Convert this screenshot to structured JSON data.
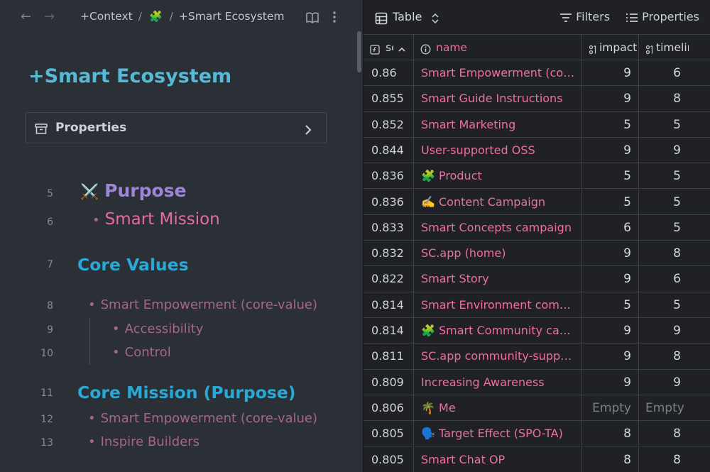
{
  "left": {
    "breadcrumb": {
      "first": "+Context",
      "separator": "/",
      "puzzle": "🧩",
      "last": "+Smart Ecosystem"
    },
    "page_title": "+Smart Ecosystem",
    "properties_label": "Properties",
    "lines": [
      {
        "num": "5",
        "text": "Purpose",
        "emoji": "⚔️"
      },
      {
        "num": "6",
        "text": "Smart Mission"
      },
      {
        "num": "7",
        "text": "Core Values"
      },
      {
        "num": "8",
        "text": "Smart Empowerment (core-value)"
      },
      {
        "num": "9",
        "text": "Accessibility"
      },
      {
        "num": "10",
        "text": "Control"
      },
      {
        "num": "11",
        "text": "Core Mission (Purpose)"
      },
      {
        "num": "12",
        "text": "Smart Empowerment (core-value)"
      },
      {
        "num": "13",
        "text": "Inspire Builders"
      }
    ],
    "bullet": "•"
  },
  "right": {
    "view_label": "Table",
    "filters_label": "Filters",
    "properties_label": "Properties",
    "columns": {
      "score": "score",
      "name": "name",
      "impact": "impact",
      "timeliness": "timeliness"
    },
    "rows": [
      {
        "score": "0.86",
        "name": "Smart Empowerment (core-value)",
        "impact": "9",
        "timeliness": "6"
      },
      {
        "score": "0.855",
        "name": "Smart Guide Instructions",
        "impact": "9",
        "timeliness": "8"
      },
      {
        "score": "0.852",
        "name": "Smart Marketing",
        "impact": "5",
        "timeliness": "5"
      },
      {
        "score": "0.844",
        "name": "User-supported OSS",
        "impact": "9",
        "timeliness": "9"
      },
      {
        "score": "0.836",
        "name": "🧩 Product",
        "impact": "5",
        "timeliness": "5"
      },
      {
        "score": "0.836",
        "name": "✍️ Content Campaign",
        "impact": "5",
        "timeliness": "5"
      },
      {
        "score": "0.833",
        "name": "Smart Concepts campaign",
        "impact": "6",
        "timeliness": "5"
      },
      {
        "score": "0.832",
        "name": "SC.app (home)",
        "impact": "9",
        "timeliness": "8"
      },
      {
        "score": "0.822",
        "name": "Smart Story",
        "impact": "9",
        "timeliness": "6"
      },
      {
        "score": "0.814",
        "name": "Smart Environment compliance",
        "impact": "5",
        "timeliness": "5"
      },
      {
        "score": "0.814",
        "name": "🧩 Smart Community campaign",
        "impact": "9",
        "timeliness": "9"
      },
      {
        "score": "0.811",
        "name": "SC.app community-supported",
        "impact": "9",
        "timeliness": "8"
      },
      {
        "score": "0.809",
        "name": "Increasing Awareness",
        "impact": "9",
        "timeliness": "9"
      },
      {
        "score": "0.806",
        "name": "🌴 Me",
        "impact": "Empty",
        "timeliness": "Empty"
      },
      {
        "score": "0.805",
        "name": "🗣️ Target Effect (SPO-TA)",
        "impact": "8",
        "timeliness": "8"
      },
      {
        "score": "0.805",
        "name": "Smart Chat OP",
        "impact": "8",
        "timeliness": "8"
      }
    ]
  },
  "colors": {
    "title": "#56b9d6",
    "purpose": "#9d86d8",
    "mission": "#e56d9b",
    "core": "#2ba9d6",
    "link": "#ed6fa0",
    "item": "#a56688"
  }
}
